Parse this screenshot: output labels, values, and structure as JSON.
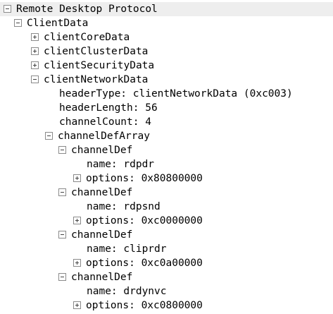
{
  "tree": {
    "root": "Remote Desktop Protocol",
    "client_data": "ClientData",
    "client_core_data": "clientCoreData",
    "client_cluster_data": "clientClusterData",
    "client_security_data": "clientSecurityData",
    "client_network_data": "clientNetworkData",
    "header_type": "headerType: clientNetworkData (0xc003)",
    "header_length": "headerLength: 56",
    "channel_count": "channelCount: 4",
    "channel_def_array": "channelDefArray",
    "channels": [
      {
        "label": "channelDef",
        "name": "name: rdpdr",
        "options": "options: 0x80800000"
      },
      {
        "label": "channelDef",
        "name": "name: rdpsnd",
        "options": "options: 0xc0000000"
      },
      {
        "label": "channelDef",
        "name": "name: cliprdr",
        "options": "options: 0xc0a00000"
      },
      {
        "label": "channelDef",
        "name": "name: drdynvc",
        "options": "options: 0xc0800000"
      }
    ]
  },
  "icons": {
    "expanded": "minus-box-icon",
    "collapsed": "plus-box-icon"
  },
  "colors": {
    "selection_background": "#eeeeee",
    "box_border": "#8a8a8a"
  }
}
